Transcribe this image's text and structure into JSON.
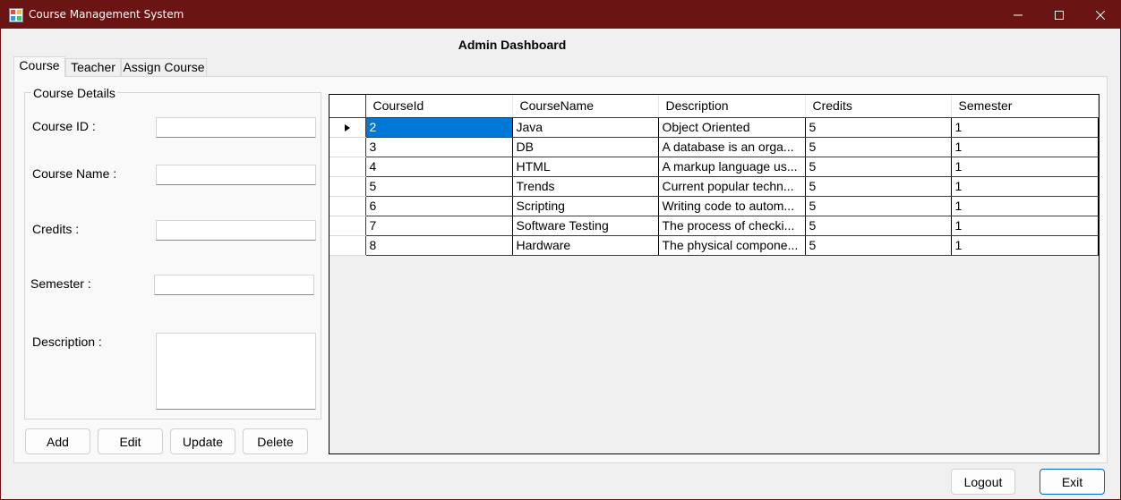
{
  "window": {
    "title": "Course Management System",
    "icon": "app-window-icon",
    "controls": [
      "minimize-icon",
      "maximize-icon",
      "close-icon"
    ]
  },
  "header": {
    "title": "Admin Dashboard"
  },
  "tabs": [
    {
      "label": "Course",
      "active": true
    },
    {
      "label": "Teacher",
      "active": false
    },
    {
      "label": "Assign Course",
      "active": false
    }
  ],
  "course_details": {
    "group_title": "Course Details",
    "course_id_label": "Course ID :",
    "course_id_value": "",
    "course_name_label": "Course Name :",
    "course_name_value": "",
    "credits_label": "Credits :",
    "credits_value": "",
    "semester_label": "Semester :",
    "semester_value": "",
    "description_label": "Description :",
    "description_value": ""
  },
  "actions": {
    "add": "Add",
    "edit": "Edit",
    "update": "Update",
    "delete": "Delete"
  },
  "grid": {
    "columns": [
      "CourseId",
      "CourseName",
      "Description",
      "Credits",
      "Semester"
    ],
    "selected_row": 0,
    "rows": [
      [
        "2",
        "Java",
        "Object Oriented",
        "5",
        "1"
      ],
      [
        "3",
        "DB",
        "A database is an orga...",
        "5",
        "1"
      ],
      [
        "4",
        "HTML",
        "A markup language us...",
        "5",
        "1"
      ],
      [
        "5",
        "Trends",
        "Current popular techn...",
        "5",
        "1"
      ],
      [
        "6",
        "Scripting",
        "Writing code to autom...",
        "5",
        "1"
      ],
      [
        "7",
        "Software Testing",
        "The process of checki...",
        "5",
        "1"
      ],
      [
        "8",
        "Hardware",
        "The physical compone...",
        "5",
        "1"
      ]
    ]
  },
  "footer": {
    "logout": "Logout",
    "exit": "Exit"
  },
  "colors": {
    "titlebar": "#6b1414",
    "selection": "#0078d7",
    "exit_border": "#0067c0"
  }
}
